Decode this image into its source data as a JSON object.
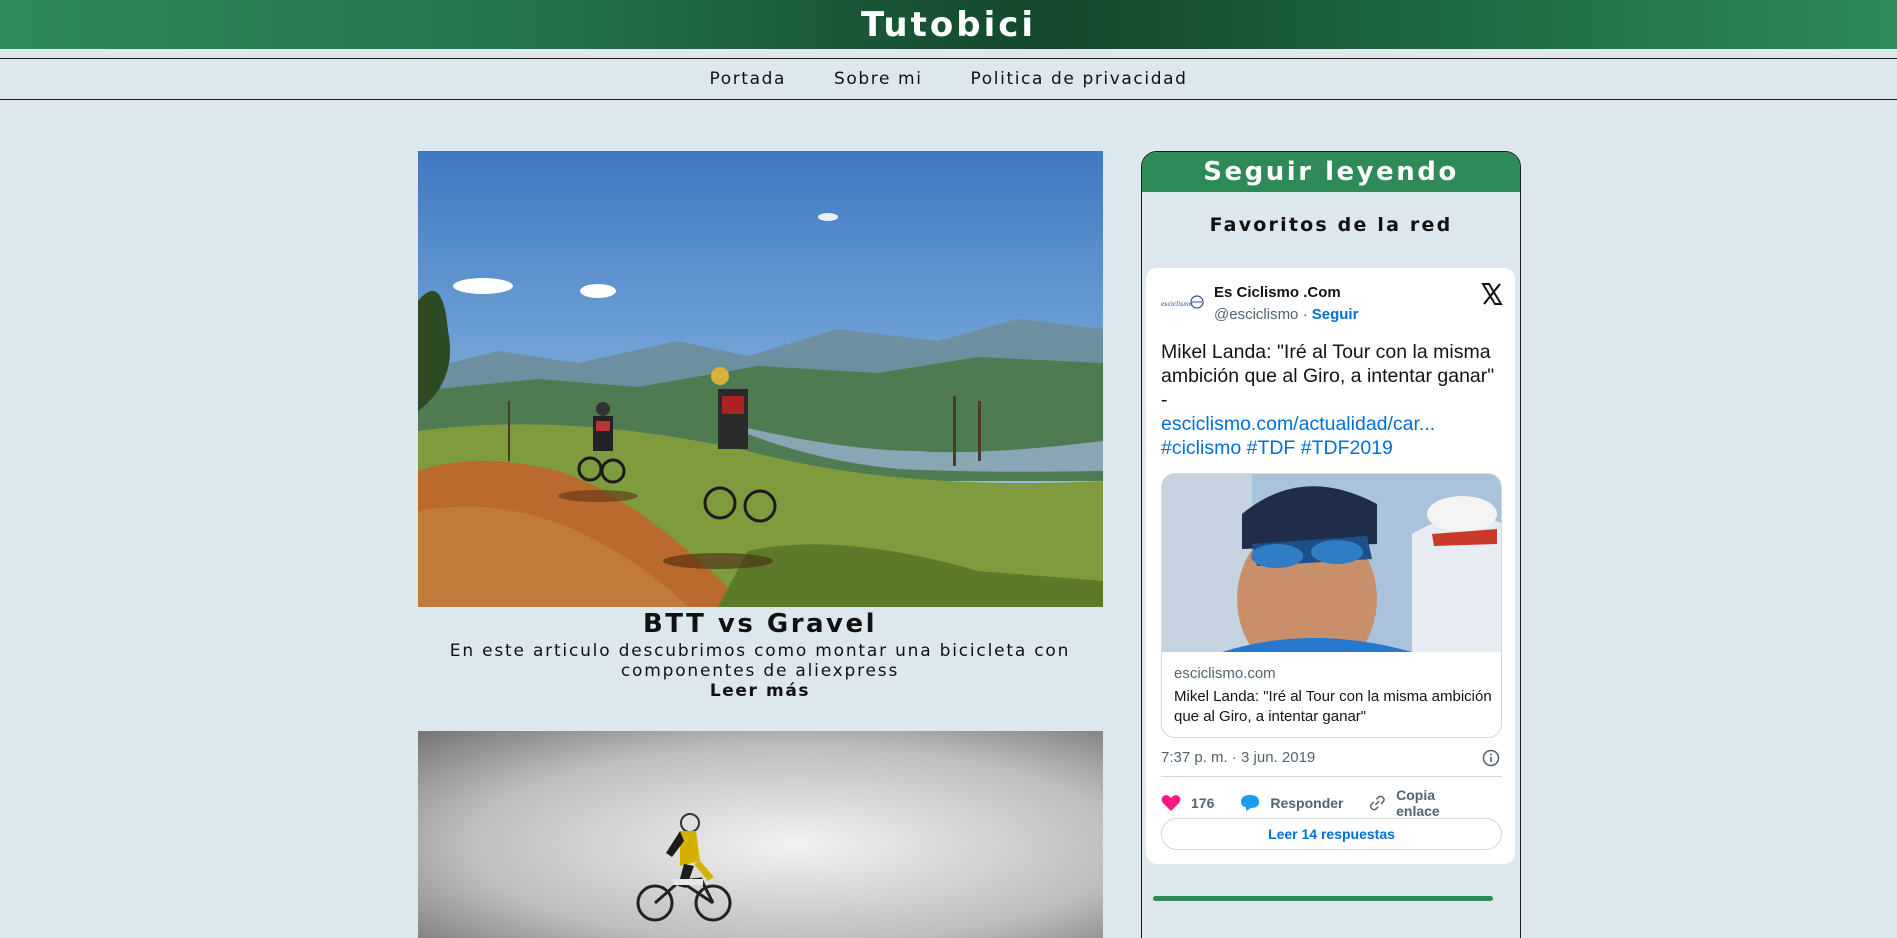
{
  "site": {
    "title": "Tutobici"
  },
  "nav": {
    "items": [
      "Portada",
      "Sobre mi",
      "Politica de privacidad"
    ]
  },
  "post": {
    "title": "BTT vs Gravel",
    "excerpt": "En este articulo descubrimos como montar una bicicleta con componentes de aliexpress",
    "read_more": "Leer más"
  },
  "sidebar": {
    "heading": "Seguir leyendo",
    "subheading": "Favoritos de la red"
  },
  "tweet": {
    "name": "Es Ciclismo .Com",
    "handle": "@esciclismo",
    "separator": " · ",
    "follow": "Seguir",
    "text": "Mikel Landa: \"Iré al Tour con la misma ambición que al Giro, a intentar ganar\" -",
    "link": "esciclismo.com/actualidad/car...",
    "hashtags": "#ciclismo #TDF #TDF2019",
    "card_domain": "esciclismo.com",
    "card_title": "Mikel Landa: \"Iré al Tour con la misma ambición que al Giro, a intentar ganar\"",
    "time": "7:37 p. m. · 3 jun. 2019",
    "likes": "176",
    "reply": "Responder",
    "copy_link": "Copia enlace",
    "read_replies": "Leer 14 respuestas"
  },
  "colors": {
    "accent_green": "#2e8b57",
    "page_bg": "#dce8ee",
    "link_blue": "#006fd6",
    "like_pink": "#f91880"
  },
  "icons": [
    "x-logo-icon",
    "info-icon",
    "heart-icon",
    "reply-bubble-icon",
    "link-icon"
  ]
}
